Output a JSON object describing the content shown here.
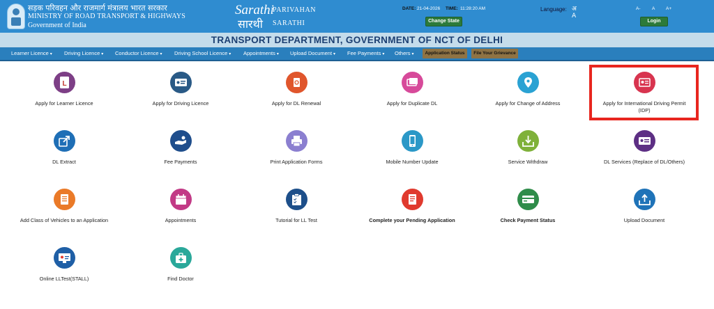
{
  "header": {
    "ministry_hindi": "सड़क परिवहन और राजमार्ग मंत्रालय भारत सरकार",
    "ministry_english": "MINISTRY OF ROAD TRANSPORT & HIGHWAYS",
    "government": "Government of India",
    "logo_sarathi_latin": "Sarathi",
    "logo_sarathi_hindi": "सारथी",
    "parivahan": "PARIVAHAN",
    "sarathi": "SARATHI",
    "date_label": "DATE:",
    "date_value": "21-04-2026",
    "time_label": "TIME:",
    "time_value": "11:28:20 AM",
    "change_state": "Change State",
    "language_label": "Language:",
    "language_icon_glyph": "अ A",
    "font_small": "A-",
    "font_normal": "A",
    "font_large": "A+",
    "login": "Login"
  },
  "title": "TRANSPORT DEPARTMENT, GOVERNMENT OF NCT OF DELHI",
  "nav": {
    "items": [
      "Learner Licence",
      "Driving Licence",
      "Conductor Licence",
      "Driving School Licence",
      "Appointments",
      "Upload Document",
      "Fee Payments",
      "Others"
    ],
    "caret": "▾",
    "application_status": "Application Status",
    "grievance": "File Your Grievance"
  },
  "tiles": [
    {
      "label": "Apply for Learner Licence",
      "icon": "learner-l-icon",
      "color": "#7d3f86"
    },
    {
      "label": "Apply for Driving Licence",
      "icon": "driving-licence-card-icon",
      "color": "#2a5a86"
    },
    {
      "label": "Apply for DL Renewal",
      "icon": "dl-renewal-icon",
      "color": "#e0562c"
    },
    {
      "label": "Apply for Duplicate DL",
      "icon": "duplicate-dl-icon",
      "color": "#d74a9a"
    },
    {
      "label": "Apply for Change of Address",
      "icon": "location-pin-icon",
      "color": "#2aa2d3"
    },
    {
      "label": "Apply for International Driving Permit",
      "label2": "(IDP)",
      "icon": "international-permit-icon",
      "color": "#d8344f"
    },
    {
      "label": "DL Extract",
      "icon": "share-out-icon",
      "color": "#1f6fb6"
    },
    {
      "label": "Fee Payments",
      "icon": "hand-coin-icon",
      "color": "#1f4e8c"
    },
    {
      "label": "Print Application Forms",
      "icon": "printer-icon",
      "color": "#8b7fd0"
    },
    {
      "label": "Mobile Number Update",
      "icon": "mobile-phone-icon",
      "color": "#2b98c7"
    },
    {
      "label": "Service Withdraw",
      "icon": "withdraw-tray-icon",
      "color": "#7fb13a"
    },
    {
      "label": "DL Services (Replace of DL/Others)",
      "icon": "id-card-icon",
      "color": "#5d2f84"
    },
    {
      "label": "Add Class of Vehicles to an Application",
      "icon": "document-list-icon",
      "color": "#ea7a28"
    },
    {
      "label": "Appointments",
      "icon": "calendar-icon",
      "color": "#c23a86"
    },
    {
      "label": "Tutorial for LL Test",
      "icon": "clipboard-icon",
      "color": "#1d4f8a"
    },
    {
      "label": "Complete your Pending Application",
      "icon": "pending-document-icon",
      "color": "#e03a2e"
    },
    {
      "label": "Check Payment Status",
      "icon": "payment-card-icon",
      "color": "#2f8c4a"
    },
    {
      "label": "Upload Document",
      "icon": "upload-icon",
      "color": "#1f73b8"
    },
    {
      "label": "Online LLTest(STALL)",
      "icon": "monitor-test-icon",
      "color": "#1f5fa6"
    },
    {
      "label": "Find Doctor",
      "icon": "doctor-bag-icon",
      "color": "#2aa89a"
    }
  ],
  "colors": {
    "header_bg": "#2f8cd0",
    "nav_bg": "#2a7fbd",
    "title_band_bg": "#c4dceb",
    "highlight": "#e8261f"
  }
}
